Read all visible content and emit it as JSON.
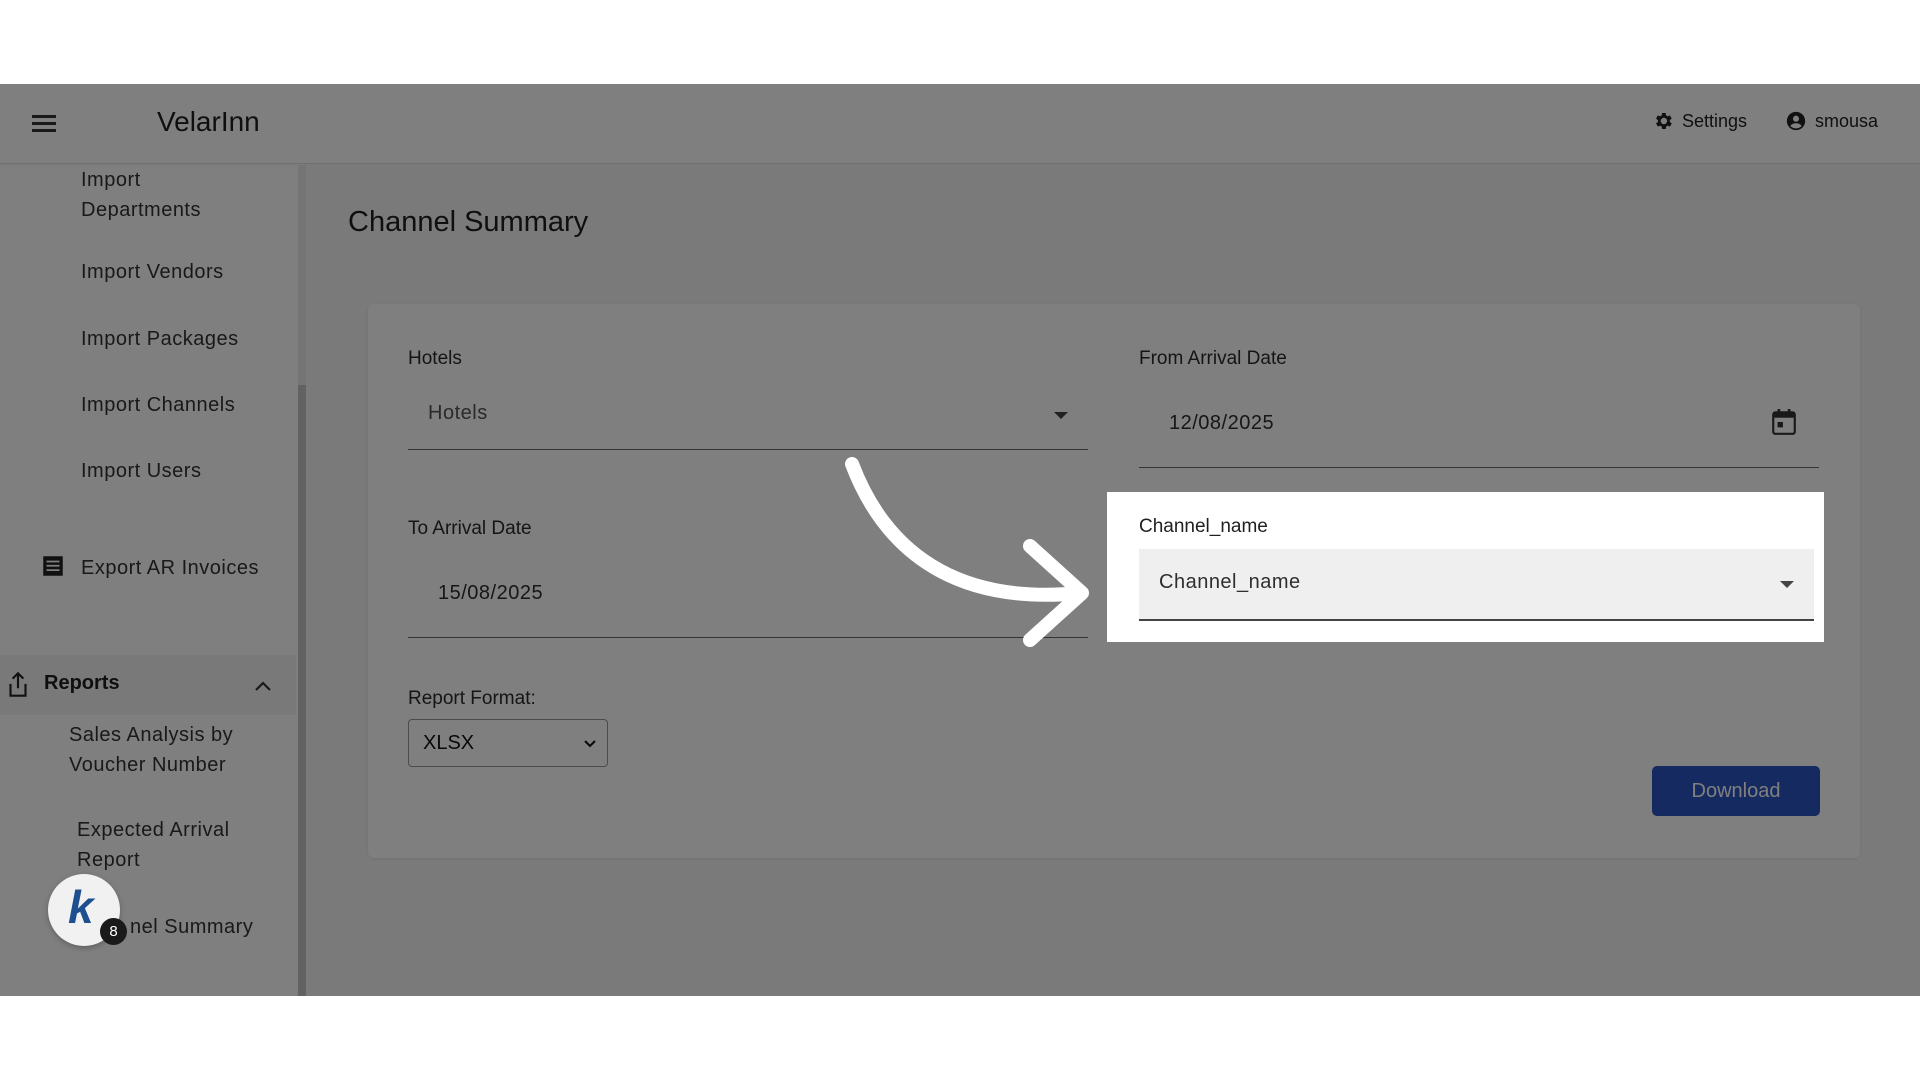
{
  "app": {
    "title": "VelarInn"
  },
  "header": {
    "settings_label": "Settings",
    "user_label": "smousa"
  },
  "sidebar": {
    "items": [
      {
        "label": "Import Departments"
      },
      {
        "label": "Import Vendors"
      },
      {
        "label": "Import Packages"
      },
      {
        "label": "Import Channels"
      },
      {
        "label": "Import Users"
      },
      {
        "label": "Export AR Invoices"
      }
    ],
    "reports_section": {
      "label": "Reports",
      "expanded": true
    },
    "report_items": [
      {
        "label": "Sales Analysis by Voucher Number"
      },
      {
        "label": "Expected Arrival Report"
      },
      {
        "label": "nel Summary"
      }
    ]
  },
  "main": {
    "page_title": "Channel Summary",
    "form": {
      "hotels_label": "Hotels",
      "hotels_value": "Hotels",
      "from_date_label": "From Arrival Date",
      "from_date_value": "12/08/2025",
      "to_date_label": "To Arrival Date",
      "to_date_value": "15/08/2025",
      "channel_label": "Channel_name",
      "channel_value": "Channel_name",
      "report_format_label": "Report Format:",
      "report_format_value": "XLSX",
      "download_label": "Download"
    }
  },
  "floating_badge": {
    "logo_letter": "k",
    "count": "8"
  },
  "colors": {
    "primary_button": "#2d55c4",
    "overlay": "rgba(0,0,0,0.5)"
  }
}
